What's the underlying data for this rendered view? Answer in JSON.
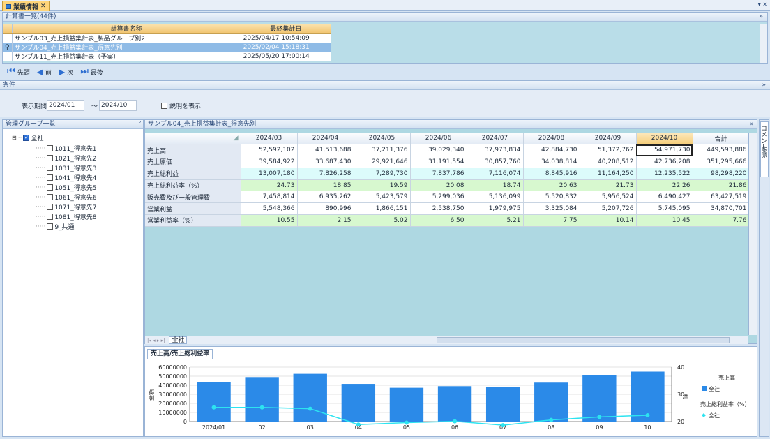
{
  "tab": {
    "title": "業績情報",
    "close": "✕"
  },
  "doclist": {
    "header": "計算書一覧(44件)",
    "columns": [
      "計算書名称",
      "最終集計日"
    ],
    "rows": [
      {
        "name": "サンプル03_売上損益集計表_製品グループ別2",
        "date": "2025/04/17 10:54:09"
      },
      {
        "name": "サンプル04_売上損益集計表_得意先別",
        "date": "2025/02/04 15:18:31"
      },
      {
        "name": "サンプル11_売上損益集計表（予実）",
        "date": "2025/05/20 17:00:14"
      }
    ]
  },
  "navbar": {
    "first": "先頭",
    "prev": "前",
    "next": "次",
    "last": "最後"
  },
  "conditions": {
    "header": "条件",
    "period_label": "表示期間",
    "from": "2024/01",
    "tilde": "～",
    "to": "2024/10",
    "show_desc": "説明を表示"
  },
  "groups": {
    "header": "管理グループ一覧",
    "pin": "ᴾ",
    "root": "全社",
    "items": [
      "1011_得意先1",
      "1021_得意先2",
      "1031_得意先3",
      "1041_得意先4",
      "1051_得意先5",
      "1061_得意先6",
      "1071_得意先7",
      "1081_得意先8",
      "9_共通"
    ]
  },
  "report": {
    "header": "サンプル04_売上損益集計表_得意先別",
    "columns": [
      "2024/03",
      "2024/04",
      "2024/05",
      "2024/06",
      "2024/07",
      "2024/08",
      "2024/09",
      "2024/10",
      "合計"
    ],
    "rows": [
      {
        "label": "売上高",
        "values": [
          "52,592,102",
          "41,513,688",
          "37,211,376",
          "39,029,340",
          "37,973,834",
          "42,884,730",
          "51,372,762",
          "54,971,730",
          "449,593,886"
        ]
      },
      {
        "label": "売上原価",
        "values": [
          "39,584,922",
          "33,687,430",
          "29,921,646",
          "31,191,554",
          "30,857,760",
          "34,038,814",
          "40,208,512",
          "42,736,208",
          "351,295,666"
        ]
      },
      {
        "label": "売上総利益",
        "values": [
          "13,007,180",
          "7,826,258",
          "7,289,730",
          "7,837,786",
          "7,116,074",
          "8,845,916",
          "11,164,250",
          "12,235,522",
          "98,298,220"
        ]
      },
      {
        "label": "売上総利益率（%）",
        "values": [
          "24.73",
          "18.85",
          "19.59",
          "20.08",
          "18.74",
          "20.63",
          "21.73",
          "22.26",
          "21.86"
        ]
      },
      {
        "label": "販売費及び一般管理費",
        "values": [
          "7,458,814",
          "6,935,262",
          "5,423,579",
          "5,299,036",
          "5,136,099",
          "5,520,832",
          "5,956,524",
          "6,490,427",
          "63,427,519"
        ]
      },
      {
        "label": "営業利益",
        "values": [
          "5,548,366",
          "890,996",
          "1,866,151",
          "2,538,750",
          "1,979,975",
          "3,325,084",
          "5,207,726",
          "5,745,095",
          "34,870,701"
        ]
      },
      {
        "label": "営業利益率（%）",
        "values": [
          "10.55",
          "2.15",
          "5.02",
          "6.50",
          "5.21",
          "7.75",
          "10.14",
          "10.45",
          "7.76"
        ]
      }
    ],
    "sheet_tab": "全社",
    "comment_side": "コメント",
    "side2": "帳票"
  },
  "chart_tab": "売上高/売上総利益率",
  "chart_data": {
    "type": "bar",
    "categories": [
      "2024/01",
      "02",
      "03",
      "04",
      "05",
      "06",
      "07",
      "08",
      "09",
      "10"
    ],
    "series": [
      {
        "name": "全社",
        "kind": "bar",
        "values": [
          43500000,
          49000000,
          52600000,
          41500000,
          37200000,
          39000000,
          38000000,
          42900000,
          51400000,
          55000000
        ]
      },
      {
        "name": "全社",
        "kind": "line",
        "values": [
          25.2,
          25.2,
          24.7,
          18.9,
          19.6,
          20.1,
          18.7,
          20.6,
          21.7,
          22.3
        ]
      }
    ],
    "ylabel": "金額",
    "y2label": "利",
    "ylim": [
      0,
      60000000
    ],
    "y2lim": [
      20,
      40
    ],
    "yticks": [
      "60000000",
      "50000000",
      "40000000",
      "30000000",
      "20000000",
      "10000000",
      "0"
    ],
    "y2ticks": [
      "40",
      "30",
      "20"
    ],
    "legend": {
      "title1": "売上高",
      "title2": "売上総利益率（%）",
      "item1": "全社",
      "item2": "全社"
    },
    "colors": {
      "bar": "#2b8ae8",
      "line": "#2de3f0"
    }
  }
}
